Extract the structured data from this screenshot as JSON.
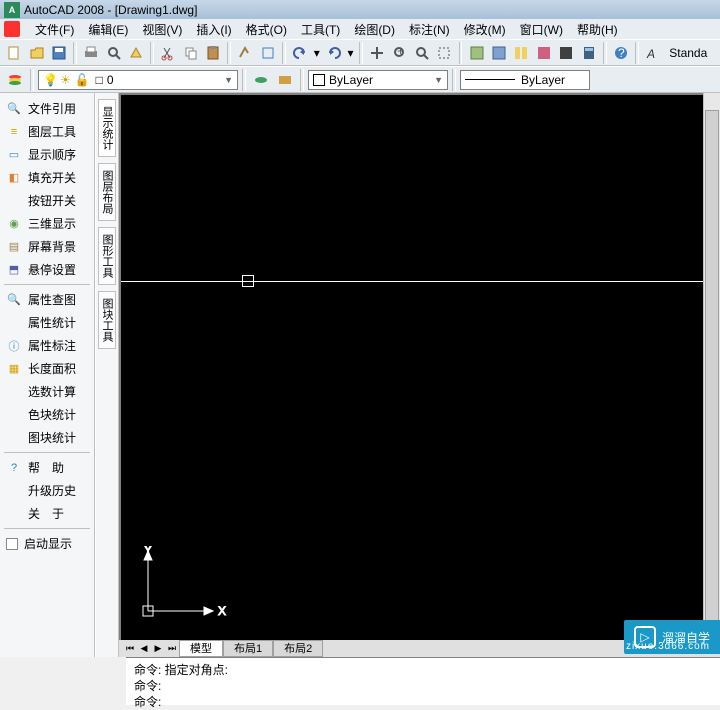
{
  "title": "AutoCAD 2008 - [Drawing1.dwg]",
  "menu": [
    "文件(F)",
    "编辑(E)",
    "视图(V)",
    "插入(I)",
    "格式(O)",
    "工具(T)",
    "绘图(D)",
    "标注(N)",
    "修改(M)",
    "窗口(W)",
    "帮助(H)"
  ],
  "layerValue": "0",
  "byLayer": "ByLayer",
  "byLayer2": "ByLayer",
  "standards": "Standa",
  "side": {
    "items": [
      {
        "label": "文件引用",
        "icon": "🔍",
        "color": "#000"
      },
      {
        "label": "图层工具",
        "icon": "≡",
        "color": "#d4a000"
      },
      {
        "label": "显示顺序",
        "icon": "▭",
        "color": "#4080d0"
      },
      {
        "label": "填充开关",
        "icon": "◧",
        "color": "#e08030"
      },
      {
        "label": "按钮开关",
        "icon": "",
        "color": ""
      },
      {
        "label": "三维显示",
        "icon": "◉",
        "color": "#60a050"
      },
      {
        "label": "屏幕背景",
        "icon": "▤",
        "color": "#a08050"
      },
      {
        "label": "悬停设置",
        "icon": "⬒",
        "color": "#5060a0"
      }
    ],
    "items2": [
      {
        "label": "属性查图",
        "icon": "🔍",
        "color": "#000"
      },
      {
        "label": "属性统计",
        "icon": "",
        "color": ""
      },
      {
        "label": "属性标注",
        "icon": "ⓘ",
        "color": "#3080c0"
      },
      {
        "label": "长度面积",
        "icon": "▦",
        "color": "#d4a000"
      },
      {
        "label": "选数计算",
        "icon": "",
        "color": ""
      },
      {
        "label": "色块统计",
        "icon": "",
        "color": ""
      },
      {
        "label": "图块统计",
        "icon": "",
        "color": ""
      }
    ],
    "items3": [
      {
        "label": "帮　助",
        "icon": "?",
        "color": "#3080c0"
      },
      {
        "label": "升级历史",
        "icon": "",
        "color": ""
      },
      {
        "label": "关　于",
        "icon": "",
        "color": ""
      }
    ],
    "startLabel": "启动显示"
  },
  "vtabs": [
    "显示统计",
    "图层布局",
    "图形工具",
    "图块工具"
  ],
  "tabs": [
    "模型",
    "布局1",
    "布局2"
  ],
  "cmd": {
    "l1": "命令:  指定对角点:",
    "l2": "命令:",
    "l3": "命令:"
  },
  "watermark": {
    "name": "溜溜自学",
    "sub": "zixue.3d66.com"
  },
  "axis": {
    "x": "X",
    "y": "Y"
  }
}
